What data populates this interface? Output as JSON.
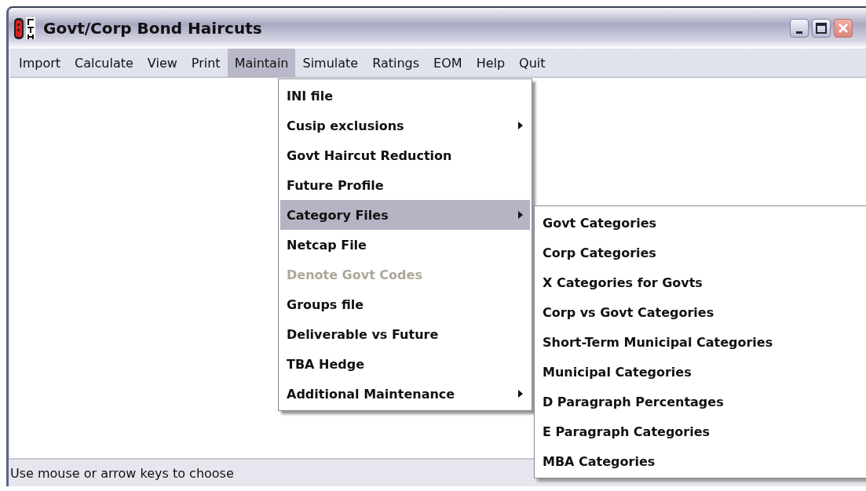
{
  "window": {
    "title": "Govt/Corp Bond Haircuts"
  },
  "menu_bar": [
    {
      "label": "Import",
      "selected": false
    },
    {
      "label": "Calculate",
      "selected": false
    },
    {
      "label": "View",
      "selected": false
    },
    {
      "label": "Print",
      "selected": false
    },
    {
      "label": "Maintain",
      "selected": true
    },
    {
      "label": "Simulate",
      "selected": false
    },
    {
      "label": "Ratings",
      "selected": false
    },
    {
      "label": "EOM",
      "selected": false
    },
    {
      "label": "Help",
      "selected": false
    },
    {
      "label": "Quit",
      "selected": false
    }
  ],
  "maintain_menu": [
    {
      "label": "INI file",
      "selected": false,
      "disabled": false,
      "submenu": false
    },
    {
      "label": "Cusip exclusions",
      "selected": false,
      "disabled": false,
      "submenu": true
    },
    {
      "label": "Govt Haircut Reduction",
      "selected": false,
      "disabled": false,
      "submenu": false
    },
    {
      "label": "Future Profile",
      "selected": false,
      "disabled": false,
      "submenu": false
    },
    {
      "label": "Category Files",
      "selected": true,
      "disabled": false,
      "submenu": true
    },
    {
      "label": "Netcap File",
      "selected": false,
      "disabled": false,
      "submenu": false
    },
    {
      "label": "Denote Govt Codes",
      "selected": false,
      "disabled": true,
      "submenu": false
    },
    {
      "label": "Groups file",
      "selected": false,
      "disabled": false,
      "submenu": false
    },
    {
      "label": "Deliverable vs Future",
      "selected": false,
      "disabled": false,
      "submenu": false
    },
    {
      "label": "TBA Hedge",
      "selected": false,
      "disabled": false,
      "submenu": false
    },
    {
      "label": "Additional Maintenance",
      "selected": false,
      "disabled": false,
      "submenu": true
    }
  ],
  "category_files_menu": [
    {
      "label": "Govt Categories",
      "selected": false
    },
    {
      "label": "Corp Categories",
      "selected": false
    },
    {
      "label": "X Categories for Govts",
      "selected": false
    },
    {
      "label": "Corp vs Govt Categories",
      "selected": false
    },
    {
      "label": "Short-Term Municipal Categories",
      "selected": false
    },
    {
      "label": "Municipal Categories",
      "selected": false
    },
    {
      "label": "D Paragraph Percentages",
      "selected": false
    },
    {
      "label": "E Paragraph Categories",
      "selected": false
    },
    {
      "label": "MBA Categories",
      "selected": false
    }
  ],
  "status_bar": "Use mouse or arrow keys to choose"
}
